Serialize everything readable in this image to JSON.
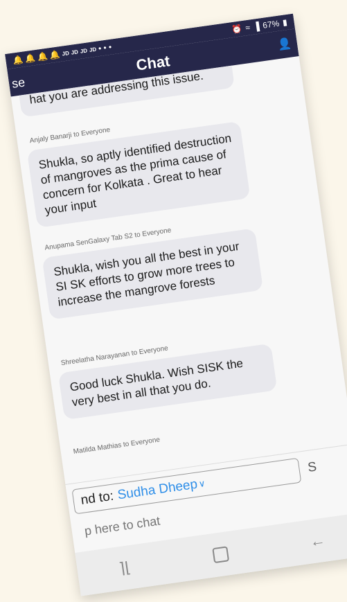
{
  "status_bar": {
    "carrier_tags": [
      "JD",
      "JD",
      "JD",
      "JD"
    ],
    "dots": "• • •",
    "battery": "67%"
  },
  "header": {
    "title": "Chat",
    "close_label": "se"
  },
  "messages": [
    {
      "sender": "",
      "text": "hat you are addressing this issue."
    },
    {
      "sender": "Anjaly Banarji to Everyone",
      "text": "Shukla, so aptly identified destruction of mangroves as the prima cause of concern for Kolkata . Great to hear your input"
    },
    {
      "sender": "Anupama SenGalaxy Tab S2 to Everyone",
      "text": "Shukla, wish you all the best in your SI SK efforts to grow more trees to increase the mangrove forests"
    },
    {
      "sender": "Shreelatha Narayanan to Everyone",
      "text": "Good luck Shukla. Wish SISK the very best in all that you do."
    },
    {
      "sender": "Matilda Mathias to Everyone",
      "text": ""
    }
  ],
  "compose": {
    "send_to_label": "nd to:",
    "recipient": "Sudha Dheep",
    "send_button": "S",
    "placeholder": "p here to chat"
  },
  "colors": {
    "header_bg": "#26274a",
    "accent": "#2e8ee8",
    "bubble_bg": "#e8e8ed"
  }
}
